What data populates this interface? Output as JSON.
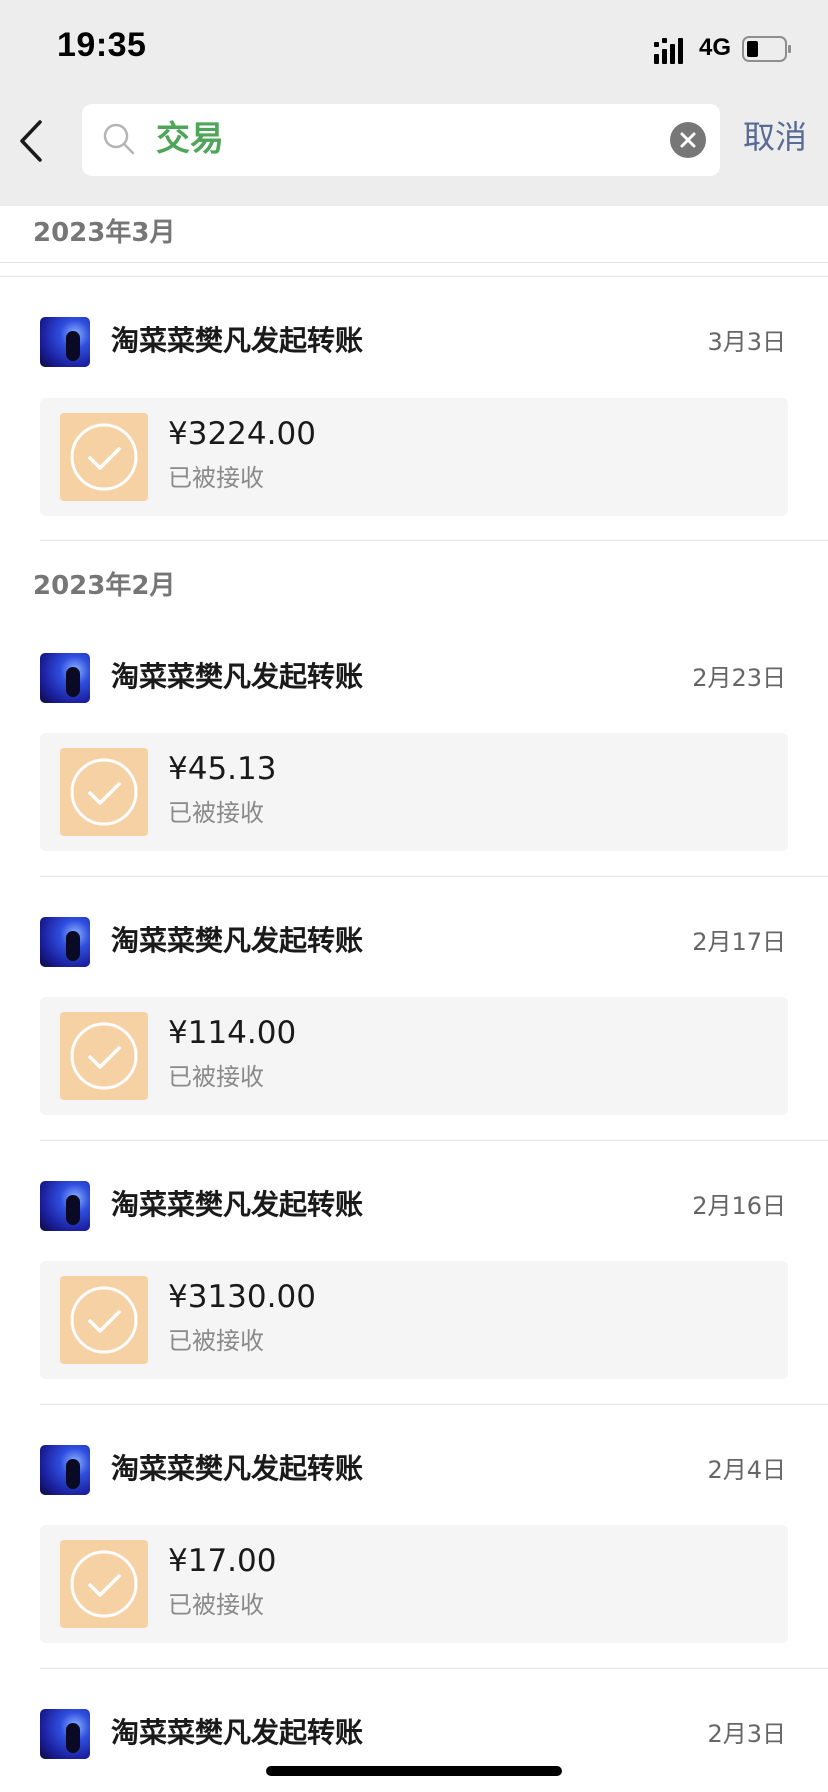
{
  "status_bar": {
    "time": "19:35",
    "network": "4G"
  },
  "search": {
    "query": "交易",
    "cancel_label": "取消"
  },
  "months": [
    {
      "label": "2023年3月"
    },
    {
      "label": "2023年2月"
    }
  ],
  "transactions": [
    {
      "title": "淘菜菜樊凡发起转账",
      "date": "3月3日",
      "amount": "¥3224.00",
      "status": "已被接收"
    },
    {
      "title": "淘菜菜樊凡发起转账",
      "date": "2月23日",
      "amount": "¥45.13",
      "status": "已被接收"
    },
    {
      "title": "淘菜菜樊凡发起转账",
      "date": "2月17日",
      "amount": "¥114.00",
      "status": "已被接收"
    },
    {
      "title": "淘菜菜樊凡发起转账",
      "date": "2月16日",
      "amount": "¥3130.00",
      "status": "已被接收"
    },
    {
      "title": "淘菜菜樊凡发起转账",
      "date": "2月4日",
      "amount": "¥17.00",
      "status": "已被接收"
    },
    {
      "title": "淘菜菜樊凡发起转账",
      "date": "2月3日"
    }
  ]
}
